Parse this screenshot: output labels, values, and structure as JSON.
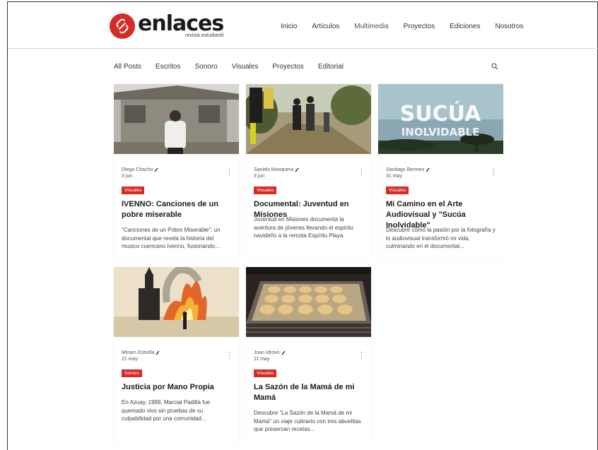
{
  "brand": {
    "name": "enlaces",
    "tagline": "revista estudiantil",
    "color": "#d52b27"
  },
  "nav": {
    "items": [
      "Inicio",
      "Artículos",
      "Multimedia",
      "Proyectos",
      "Ediciones",
      "Nosotros"
    ],
    "active": "Multimedia"
  },
  "categories": [
    "All Posts",
    "Escritos",
    "Sonoro",
    "Visuales",
    "Proyectos",
    "Editorial"
  ],
  "search_icon": "search-icon",
  "posts": [
    {
      "author": "Diego Chacho",
      "date": "3 jun",
      "tag": "Visuales",
      "title": "IVENNO: Canciones de un pobre miserable",
      "excerpt": "\"Canciones de un Pobre Miserable\": un documental que revela la historia del musico cuencano Ivenno, fusionando..."
    },
    {
      "author": "Saniels Mosquera",
      "date": "3 jun",
      "tag": "Visuales",
      "title": "Documental: Juventud en Misiones",
      "excerpt": "Juventud en Misiones documenta la aventura de jóvenes llevando el espíritu navideño a la remota Espíritu Playa."
    },
    {
      "author": "Santiago Bermeo",
      "date": "31 may",
      "tag": "Visuales",
      "title": "Mi Camino en el Arte Audiovisual y \"Sucúa Inolvidable\"",
      "excerpt": "Descubre cómo la pasión por la fotografía y lo audiovisual transformó mi vida, culminando en el documental...",
      "image_text_1": "SUCÚA",
      "image_text_2": "INOLVIDABLE"
    },
    {
      "author": "Miriam Estrella",
      "date": "21 may",
      "tag": "Sonoro",
      "title": "Justicia por Mano Propia",
      "excerpt": "En Azuay, 1999, Marcial Padilla fue quemado vivo sin pruebas de su culpabilidad por una comunidad..."
    },
    {
      "author": "Joan Idrovo",
      "date": "11 may",
      "tag": "Visuales",
      "title": "La Sazón de la Mamá de mi Mamá",
      "excerpt": "Descubre \"La Sazón de la Mamá de mi Mamá\" un viaje culinario con tres abuelitas que preservan recetas..."
    }
  ]
}
